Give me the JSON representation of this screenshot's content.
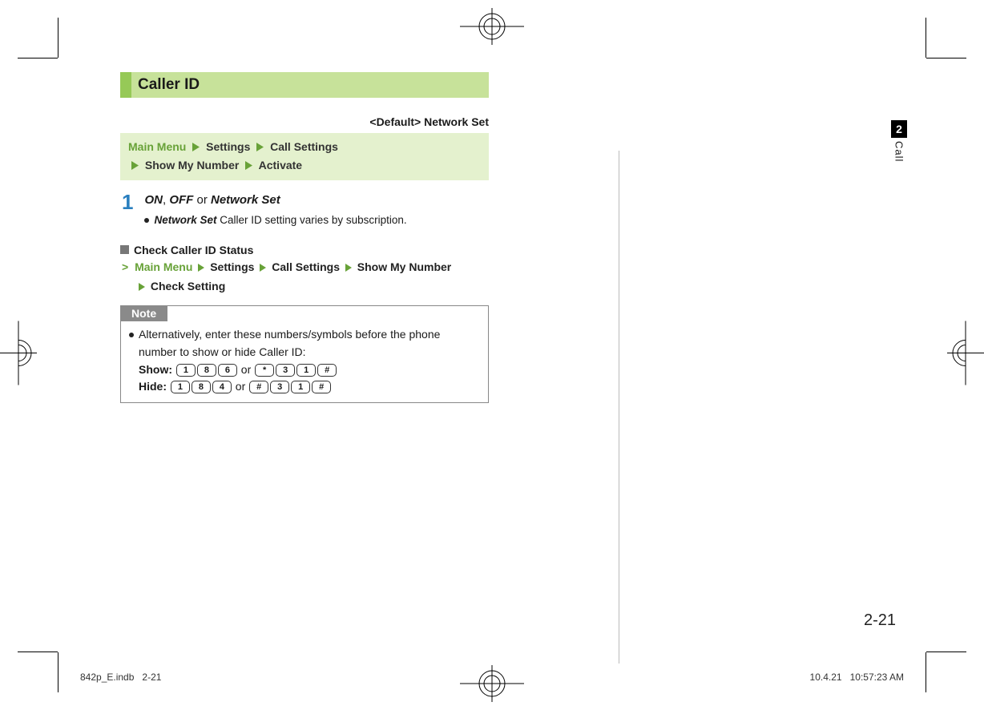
{
  "section": {
    "title": "Caller ID",
    "default_label": "<Default> Network Set"
  },
  "nav_path": {
    "main": "Main Menu",
    "items": [
      "Settings",
      "Call Settings",
      "Show My Number",
      "Activate"
    ]
  },
  "step": {
    "number": "1",
    "options": {
      "on": "ON",
      "off": "OFF",
      "net": "Network Set",
      "separator": ",",
      "or": "or"
    },
    "sub": {
      "label": "Network Set",
      "text": "Caller ID setting varies by subscription."
    }
  },
  "check": {
    "heading": "Check Caller ID Status",
    "trail": {
      "main": "Main Menu",
      "items": [
        "Settings",
        "Call Settings",
        "Show My Number",
        "Check Setting"
      ]
    }
  },
  "note": {
    "label": "Note",
    "intro": "Alternatively, enter these numbers/symbols before the phone number to show or hide Caller ID:",
    "show_label": "Show:",
    "hide_label": "Hide:",
    "or": "or",
    "show_seq1": [
      "1",
      "8",
      "6"
    ],
    "show_seq2": [
      "*",
      "3",
      "1",
      "#"
    ],
    "hide_seq1": [
      "1",
      "8",
      "4"
    ],
    "hide_seq2": [
      "#",
      "3",
      "1",
      "#"
    ]
  },
  "side_tab": {
    "num": "2",
    "label": "Call"
  },
  "page_number": "2-21",
  "footer": {
    "left_file": "842p_E.indb",
    "left_pg": "2-21",
    "right_date": "10.4.21",
    "right_time": "10:57:23 AM"
  }
}
